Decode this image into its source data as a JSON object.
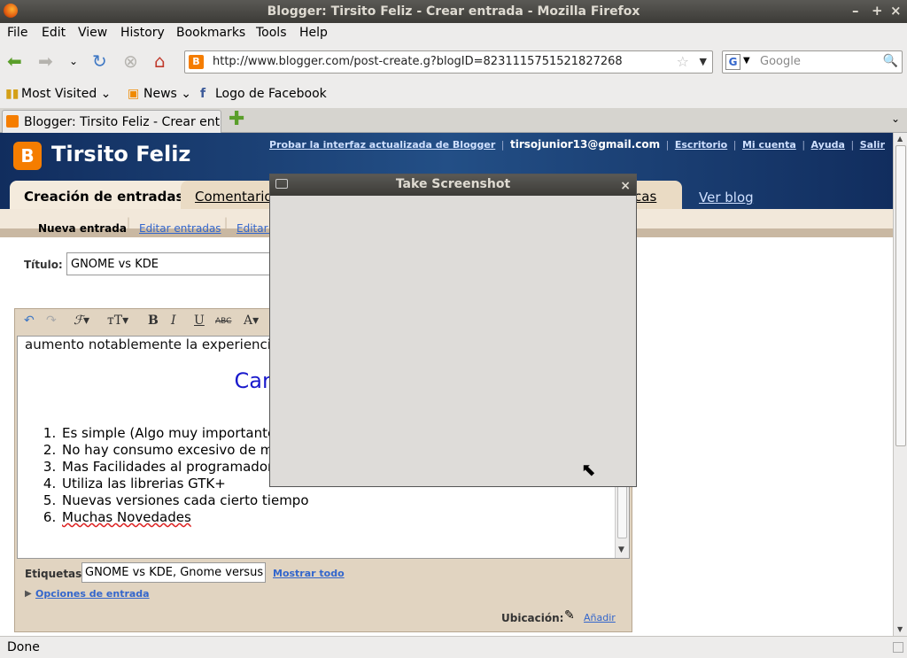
{
  "window": {
    "title": "Blogger: Tirsito Feliz - Crear entrada - Mozilla Firefox",
    "minimize": "–",
    "maximize": "+",
    "close": "×"
  },
  "menu": [
    "File",
    "Edit",
    "View",
    "History",
    "Bookmarks",
    "Tools",
    "Help"
  ],
  "nav": {
    "url": "http://www.blogger.com/post-create.g?blogID=8231115751521827268",
    "search_placeholder": "Google",
    "search_engine_letter": "G"
  },
  "bookmarks": [
    "Most Visited",
    "News",
    "Logo de Facebook"
  ],
  "tabs": [
    {
      "label": "Blogger: Tirsito Feliz - Crear ent..."
    }
  ],
  "blogger": {
    "blog_name": "Tirsito Feliz",
    "top_links": {
      "try_new": "Probar la interfaz actualizada de Blogger",
      "email": "tirsojunior13@gmail.com",
      "desktop": "Escritorio",
      "account": "Mi cuenta",
      "help": "Ayuda",
      "logout": "Salir"
    },
    "main_tabs": {
      "create": "Creación de entradas",
      "comments": "Comentarios",
      "stats": "ticas",
      "view_blog": "Ver blog"
    },
    "sub_tabs": {
      "new_post": "Nueva entrada",
      "edit_posts": "Editar entradas",
      "edit_pages": "Editar p"
    },
    "title_label": "Título:",
    "title_value": "GNOME vs KDE",
    "editor": {
      "intro": "aumento notablemente la experiencia del usuario final.",
      "heading": "Caracteristicas:",
      "items": [
        "Es simple (Algo muy importante)",
        "No hay consumo excesivo de memoria",
        "Mas Facilidades al programador",
        "Utiliza las librerias GTK+",
        "Nuevas versiones cada cierto tiempo",
        "Muchas Novedades"
      ]
    },
    "labels_label": "Etiquetas:",
    "labels_value": "GNOME vs KDE, Gnome versus I",
    "show_all": "Mostrar todo",
    "post_options": "Opciones de entrada",
    "location_label": "Ubicación:",
    "add": "Añadir"
  },
  "dialog": {
    "title": "Take Screenshot",
    "close": "×"
  },
  "status": "Done"
}
